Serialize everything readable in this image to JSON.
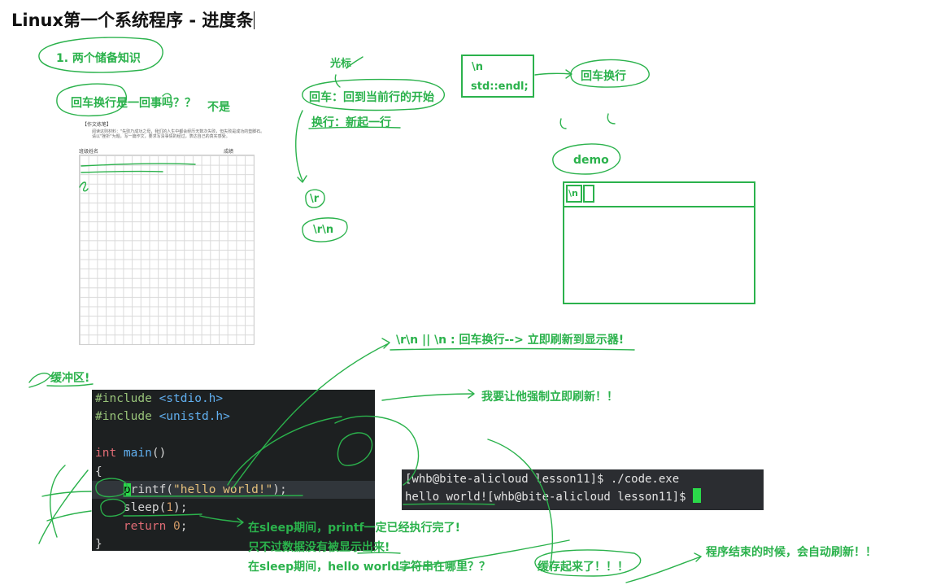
{
  "title": "Linux第一个系统程序 - 进度条",
  "notes": {
    "prereq": "1. 两个储备知识",
    "question": "回车换行是一回事吗？？",
    "answer": "不是",
    "cursor": "光标",
    "cr_def": "回车：回到当前行的开始",
    "lf_def": "换行：新起一行",
    "cr": "\\r",
    "crlf": "\\r\\n",
    "endl_n": "\\n",
    "endl_std": "std::endl;",
    "endl_meaning": "回车换行",
    "demo": "demo",
    "demo_cell": "\\n",
    "flush_rule": "\\r\\n || \\n : 回车换行--> 立即刷新到显示器!",
    "buffer": "缓冲区!",
    "force_flush": "我要让他强制立即刷新！！",
    "during_sleep": "在sleep期间，printf一定已经执行完了!",
    "not_shown": "只不过数据没有被显示出来!",
    "where_str": "在sleep期间，hello world字符串在哪里？？",
    "cached": "缓存起来了！！！",
    "auto_flush": "程序结束的时候，会自动刷新！！"
  },
  "paper": {
    "heading": "【作文练笔】",
    "prompt": "阅读这则材料：\"失败乃成功之母，我们的人生中都会经历无数次失败，但失败是成功的垫脚石。请以\"挫折\"为题，写一篇作文，要求写清事情的经过，表达自己的真实感受。",
    "name_label": "班级姓名",
    "score_label": "成绩"
  },
  "code": {
    "l1a": "#include",
    "l1b": " <stdio.h>",
    "l2a": "#include",
    "l2b": " <unistd.h>",
    "l4a": "int",
    "l4b": " main",
    "l4c": "()",
    "l5": "{",
    "l6a": "    ",
    "l6cur": "p",
    "l6b": "rintf(",
    "l6c": "\"hello world!\"",
    "l6d": ");",
    "l7a": "    sleep(",
    "l7b": "1",
    "l7c": ");",
    "l8a": "    return",
    "l8b": " 0",
    "l8c": ";",
    "l9": "}"
  },
  "terminal": {
    "line1": "[whb@bite-alicloud lesson11]$ ./code.exe",
    "line2": "hello world![whb@bite-alicloud lesson11]$ "
  },
  "colors": {
    "ink": "#2bb24c",
    "code_bg": "#1d2021",
    "term_bg": "#2b2d31"
  }
}
